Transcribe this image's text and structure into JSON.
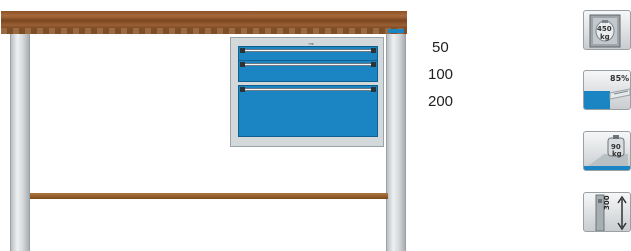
{
  "load_options": [
    "50",
    "100",
    "200"
  ],
  "icons": {
    "cabinet_load_weight": "450",
    "cabinet_load_unit": "kg",
    "drawer_extension": "85%",
    "drawer_load_weight": "90",
    "drawer_load_unit": "kg",
    "height_adjust": "300"
  },
  "colors": {
    "drawer_blue": "#1a85c2",
    "wood": "#8a5226",
    "frame_grey": "#d3d8db"
  }
}
